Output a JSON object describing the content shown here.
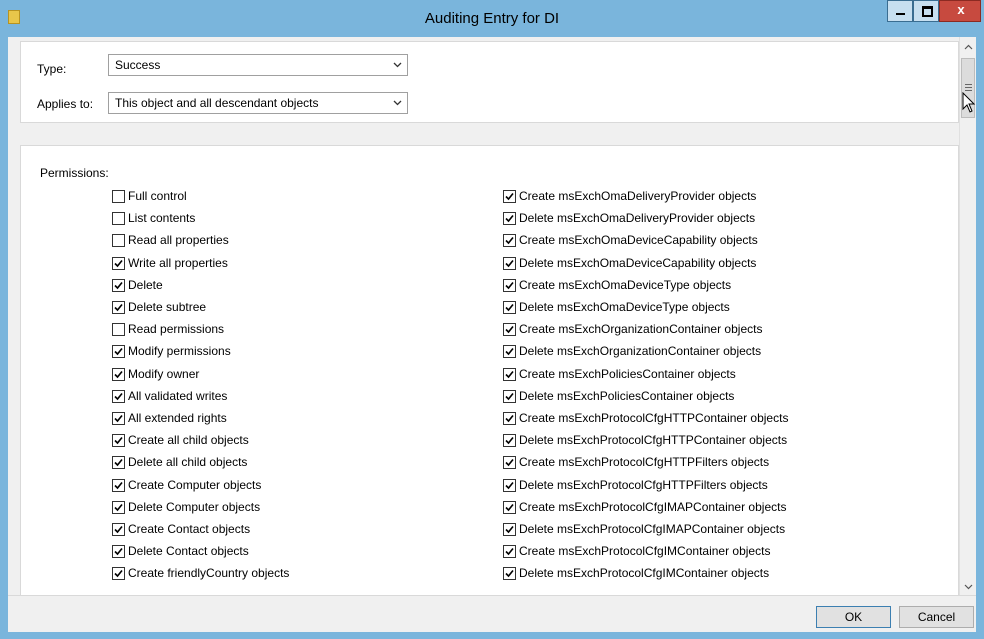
{
  "window": {
    "title": "Auditing Entry for DI"
  },
  "type_field": {
    "label": "Type:",
    "value": "Success"
  },
  "applies_field": {
    "label": "Applies to:",
    "value": "This object and all descendant objects"
  },
  "permissions": {
    "label": "Permissions:",
    "left": [
      {
        "label": "Full control",
        "checked": false
      },
      {
        "label": "List contents",
        "checked": false
      },
      {
        "label": "Read all properties",
        "checked": false
      },
      {
        "label": "Write all properties",
        "checked": true
      },
      {
        "label": "Delete",
        "checked": true
      },
      {
        "label": "Delete subtree",
        "checked": true
      },
      {
        "label": "Read permissions",
        "checked": false
      },
      {
        "label": "Modify permissions",
        "checked": true
      },
      {
        "label": "Modify owner",
        "checked": true
      },
      {
        "label": "All validated writes",
        "checked": true
      },
      {
        "label": "All extended rights",
        "checked": true
      },
      {
        "label": "Create all child objects",
        "checked": true
      },
      {
        "label": "Delete all child objects",
        "checked": true
      },
      {
        "label": "Create Computer objects",
        "checked": true
      },
      {
        "label": "Delete Computer objects",
        "checked": true
      },
      {
        "label": "Create Contact objects",
        "checked": true
      },
      {
        "label": "Delete Contact objects",
        "checked": true
      },
      {
        "label": "Create friendlyCountry objects",
        "checked": true
      }
    ],
    "right": [
      {
        "label": "Create msExchOmaDeliveryProvider objects",
        "checked": true
      },
      {
        "label": "Delete msExchOmaDeliveryProvider objects",
        "checked": true
      },
      {
        "label": "Create msExchOmaDeviceCapability objects",
        "checked": true
      },
      {
        "label": "Delete msExchOmaDeviceCapability objects",
        "checked": true
      },
      {
        "label": "Create msExchOmaDeviceType objects",
        "checked": true
      },
      {
        "label": "Delete msExchOmaDeviceType objects",
        "checked": true
      },
      {
        "label": "Create msExchOrganizationContainer objects",
        "checked": true
      },
      {
        "label": "Delete msExchOrganizationContainer objects",
        "checked": true
      },
      {
        "label": "Create msExchPoliciesContainer objects",
        "checked": true
      },
      {
        "label": "Delete msExchPoliciesContainer objects",
        "checked": true
      },
      {
        "label": "Create msExchProtocolCfgHTTPContainer objects",
        "checked": true
      },
      {
        "label": "Delete msExchProtocolCfgHTTPContainer objects",
        "checked": true
      },
      {
        "label": "Create msExchProtocolCfgHTTPFilters objects",
        "checked": true
      },
      {
        "label": "Delete msExchProtocolCfgHTTPFilters objects",
        "checked": true
      },
      {
        "label": "Create msExchProtocolCfgIMAPContainer objects",
        "checked": true
      },
      {
        "label": "Delete msExchProtocolCfgIMAPContainer objects",
        "checked": true
      },
      {
        "label": "Create msExchProtocolCfgIMContainer objects",
        "checked": true
      },
      {
        "label": "Delete msExchProtocolCfgIMContainer objects",
        "checked": true
      }
    ]
  },
  "buttons": {
    "ok": "OK",
    "cancel": "Cancel"
  }
}
